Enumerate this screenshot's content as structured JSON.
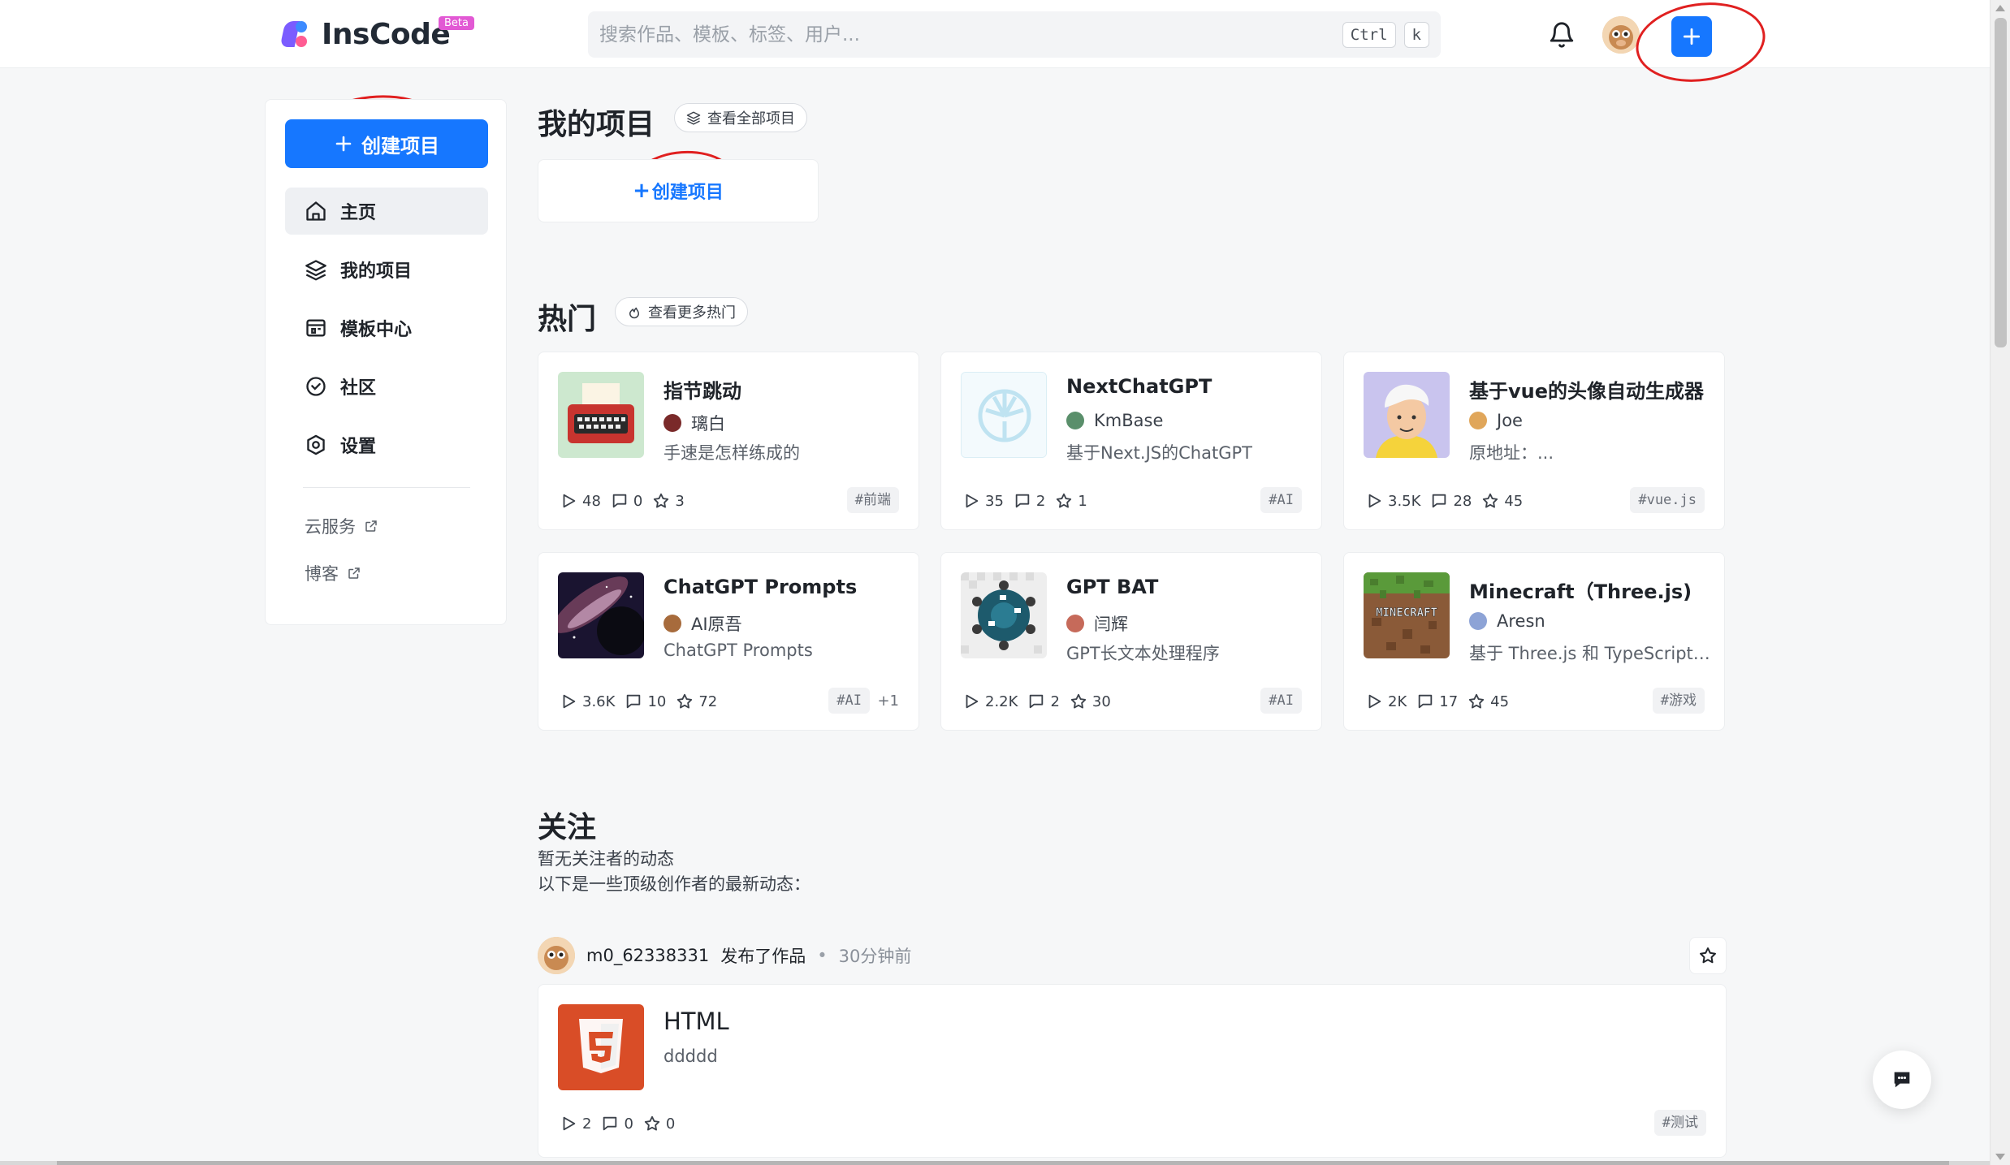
{
  "header": {
    "logo_text": "InsCode",
    "beta_label": "Beta",
    "search_placeholder": "搜索作品、模板、标签、用户...",
    "kbd_ctrl": "Ctrl",
    "kbd_k": "k",
    "create_icon": "plus-icon",
    "bell_icon": "bell-icon"
  },
  "sidebar": {
    "create_label": "创建项目",
    "items": [
      {
        "label": "主页",
        "icon": "home-icon",
        "active": true
      },
      {
        "label": "我的项目",
        "icon": "layers-icon"
      },
      {
        "label": "模板中心",
        "icon": "template-icon"
      },
      {
        "label": "社区",
        "icon": "community-icon"
      },
      {
        "label": "设置",
        "icon": "settings-icon"
      }
    ],
    "links": [
      {
        "label": "云服务",
        "icon": "external-link-icon"
      },
      {
        "label": "博客",
        "icon": "external-link-icon"
      }
    ]
  },
  "my_projects": {
    "title": "我的项目",
    "view_all": "查看全部项目",
    "create_label": "创建项目"
  },
  "hot": {
    "title": "热门",
    "view_more": "查看更多热门",
    "cards": [
      {
        "title": "指节跳动",
        "author": "璃白",
        "desc": "手速是怎样练成的",
        "runs": "48",
        "comments": "0",
        "stars": "3",
        "tag": "#前端",
        "extra": ""
      },
      {
        "title": "NextChatGPT",
        "author": "KmBase",
        "desc": "基于Next.JS的ChatGPT",
        "runs": "35",
        "comments": "2",
        "stars": "1",
        "tag": "#AI",
        "extra": ""
      },
      {
        "title": "基于vue的头像自动生成器",
        "author": "Joe",
        "desc": "原地址：...",
        "runs": "3.5K",
        "comments": "28",
        "stars": "45",
        "tag": "#vue.js",
        "extra": ""
      },
      {
        "title": "ChatGPT Prompts",
        "author": "AI原吾",
        "desc": "ChatGPT Prompts",
        "runs": "3.6K",
        "comments": "10",
        "stars": "72",
        "tag": "#AI",
        "extra": "+1"
      },
      {
        "title": "GPT BAT",
        "author": "闫辉",
        "desc": "GPT长文本处理程序",
        "runs": "2.2K",
        "comments": "2",
        "stars": "30",
        "tag": "#AI",
        "extra": ""
      },
      {
        "title": "Minecraft（Three.js)",
        "author": "Aresn",
        "desc": "基于 Three.js 和 TypeScript 的...",
        "runs": "2K",
        "comments": "17",
        "stars": "45",
        "tag": "#游戏",
        "extra": ""
      }
    ]
  },
  "follow": {
    "title": "关注",
    "empty_text": "暂无关注者的动态",
    "sub_text": "以下是一些顶级创作者的最新动态：",
    "feed": {
      "user": "m0_62338331",
      "action": "发布了作品",
      "dot": "•",
      "time": "30分钟前",
      "project_title": "HTML",
      "project_desc": "ddddd",
      "runs": "2",
      "comments": "0",
      "stars": "0",
      "tag": "#测试"
    }
  },
  "colors": {
    "primary": "#1677ff",
    "annotation": "#e02020"
  }
}
